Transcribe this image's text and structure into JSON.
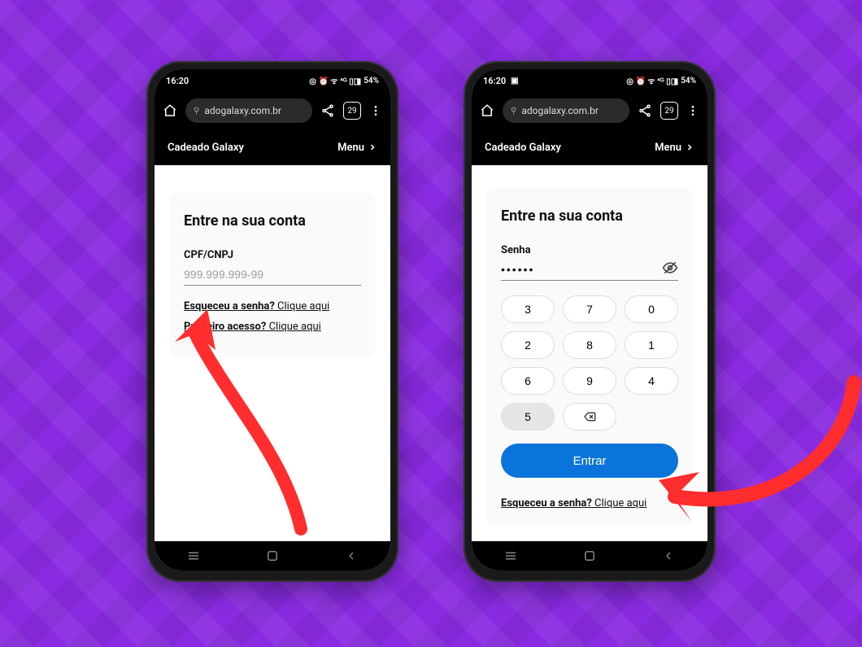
{
  "status": {
    "time": "16:20",
    "image_icon": "▣",
    "battery_text": "54%",
    "indicators": "◎ ⏰ ᯤ ⁴ᴳ ▯◨"
  },
  "browser": {
    "site_settings_glyph": "⚙",
    "url": "adogalaxy.com.br",
    "tab_count": "29"
  },
  "site_header": {
    "title": "Cadeado Galaxy",
    "menu_label": "Menu"
  },
  "page": {
    "title": "Entre na sua conta",
    "forgot_bold": "Esqueceu a senha?",
    "forgot_rest": " Clique aqui",
    "first_bold": "Primeiro acesso?",
    "first_rest": " Clique aqui"
  },
  "left_screen": {
    "field_label": "CPF/CNPJ",
    "placeholder": "999.999.999-99"
  },
  "right_screen": {
    "field_label": "Senha",
    "masked_value": "••••••",
    "keypad_rows": [
      [
        "3",
        "7",
        "0"
      ],
      [
        "2",
        "8",
        "1"
      ],
      [
        "6",
        "9",
        "4"
      ]
    ],
    "last_row_key": "5",
    "submit_label": "Entrar"
  },
  "colors": {
    "accent_purple": "#8a2be2",
    "cta_blue": "#0a74da",
    "arrow_red": "#ff2d2d"
  }
}
